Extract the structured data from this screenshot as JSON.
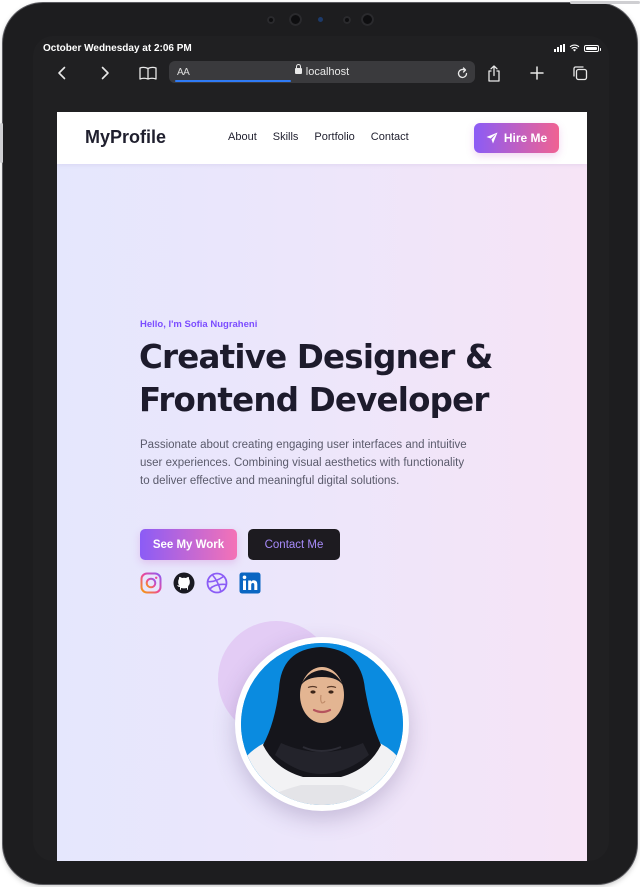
{
  "status_bar": {
    "time": "October Wednesday at 2:06 PM"
  },
  "browser": {
    "text_size_label": "AA",
    "url": "localhost"
  },
  "site": {
    "logo": "MyProfile",
    "nav": [
      "About",
      "Skills",
      "Portfolio",
      "Contact"
    ],
    "hire_button": "Hire Me"
  },
  "hero": {
    "greeting": "Hello, I'm Sofia Nugraheni",
    "title_line1": "Creative Designer &",
    "title_line2": "Frontend Developer",
    "description": "Passionate about creating engaging user interfaces and intuitive user experiences. Combining visual aesthetics with functionality to deliver effective and meaningful digital solutions.",
    "primary_button": "See My Work",
    "secondary_button": "Contact Me",
    "socials": [
      "instagram-icon",
      "github-icon",
      "dribbble-icon",
      "linkedin-icon"
    ]
  },
  "colors": {
    "accent_purple": "#8b5cf6",
    "accent_pink": "#f06292",
    "heading": "#1d1b2c",
    "greeting": "#7c4dff",
    "avatar_bg": "#0a8be0"
  }
}
